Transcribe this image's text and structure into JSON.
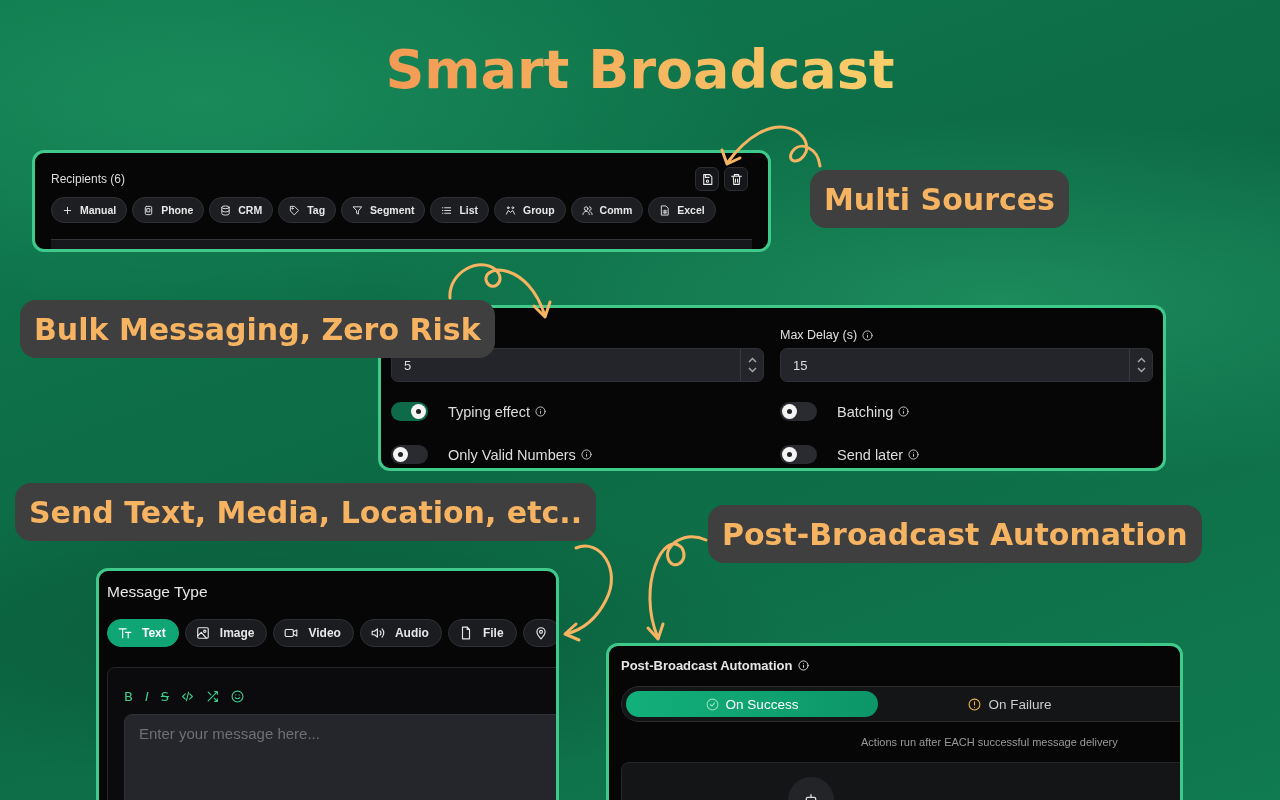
{
  "title": "Smart Broadcast",
  "recipients_panel": {
    "title": "Recipients (6)",
    "sources": [
      {
        "kind": "plus",
        "label": "Manual"
      },
      {
        "kind": "phone",
        "label": "Phone"
      },
      {
        "kind": "database",
        "label": "CRM"
      },
      {
        "kind": "tag",
        "label": "Tag"
      },
      {
        "kind": "filter",
        "label": "Segment"
      },
      {
        "kind": "list",
        "label": "List"
      },
      {
        "kind": "group",
        "label": "Group"
      },
      {
        "kind": "users",
        "label": "Comm"
      },
      {
        "kind": "sheet",
        "label": "Excel"
      }
    ]
  },
  "callouts": [
    {
      "text": "Multi Sources"
    },
    {
      "text": "Bulk Messaging, Zero Risk"
    },
    {
      "text": "Send Text, Media, Location, etc.."
    },
    {
      "text": "Post-Broadcast Automation"
    }
  ],
  "delay_panel": {
    "fields": [
      {
        "value": "5"
      },
      {
        "label": "Max Delay (s)",
        "value": "15"
      }
    ],
    "toggles": [
      {
        "label": "Typing effect",
        "on": true
      },
      {
        "label": "Batching",
        "on": false
      },
      {
        "label": "Only Valid Numbers",
        "on": false
      },
      {
        "label": "Send later",
        "on": false
      }
    ]
  },
  "message_panel": {
    "title": "Message Type",
    "types": [
      {
        "kind": "text",
        "label": "Text",
        "selected": true
      },
      {
        "kind": "image",
        "label": "Image",
        "selected": false
      },
      {
        "kind": "video",
        "label": "Video",
        "selected": false
      },
      {
        "kind": "audio",
        "label": "Audio",
        "selected": false
      },
      {
        "kind": "file",
        "label": "File",
        "selected": false
      },
      {
        "kind": "location",
        "selected": false
      }
    ],
    "format_tools": [
      {
        "kind": "bold",
        "label": "B"
      },
      {
        "kind": "italic",
        "label": "I"
      },
      {
        "kind": "strike",
        "label": "S"
      },
      {
        "kind": "code"
      },
      {
        "kind": "shuffle"
      },
      {
        "kind": "emoji"
      }
    ],
    "message": {
      "placeholder": "Enter your message here..."
    }
  },
  "automation_panel": {
    "title": "Post-Broadcast Automation",
    "tabs": [
      {
        "kind": "success",
        "label": "On Success",
        "selected": true
      },
      {
        "kind": "failure",
        "label": "On Failure",
        "selected": false
      }
    ],
    "note": "Actions run after EACH successful message delivery"
  }
}
